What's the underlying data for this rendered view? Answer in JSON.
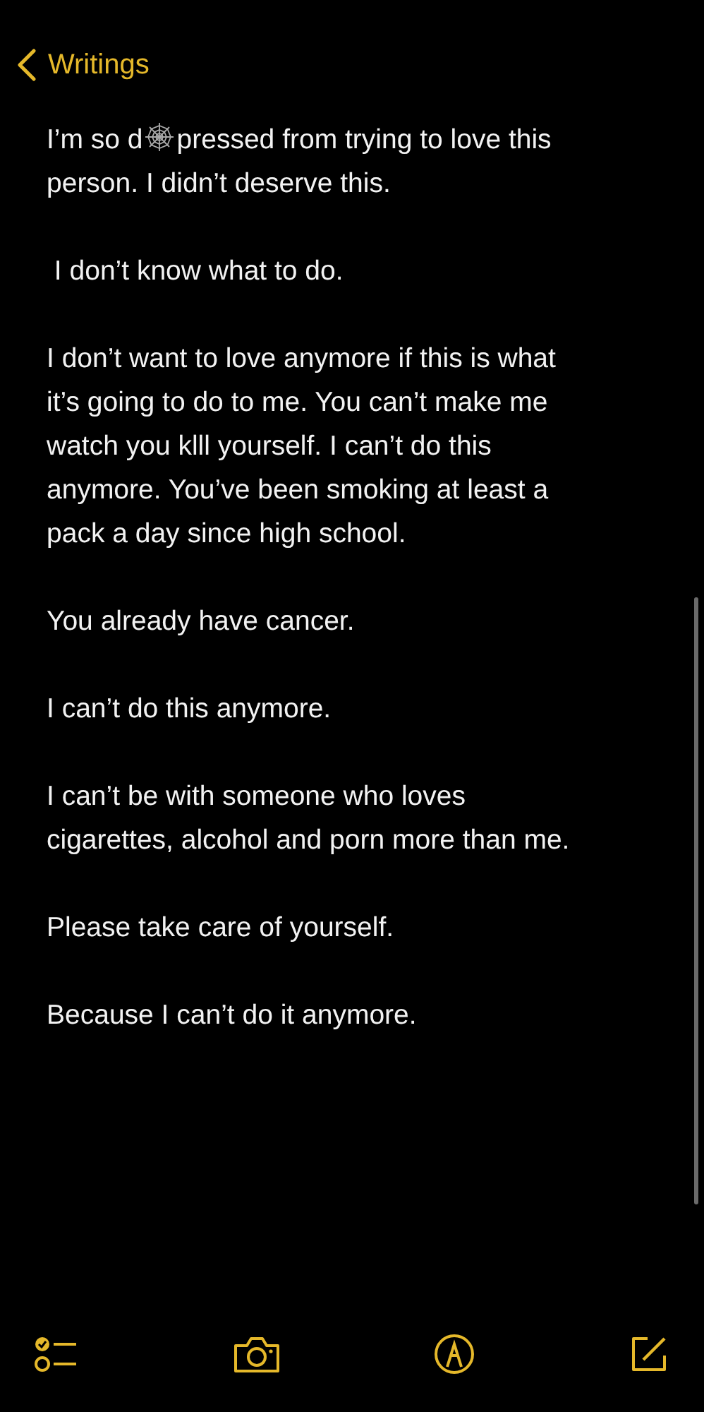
{
  "nav": {
    "back_label": "Writings"
  },
  "note": {
    "paragraphs": [
      {
        "kind": "icon_start",
        "before": "I’m so d",
        "after": "pressed from trying to love this",
        "lines": [
          "person. I didn’t deserve this."
        ]
      },
      {
        "kind": "text",
        "lines": [
          " I don’t know what to do."
        ]
      },
      {
        "kind": "text",
        "lines": [
          "I don’t want to love anymore if this is what",
          "it’s going to do to me. You can’t make me",
          "watch you klll yourself. I can’t do this",
          "anymore. You’ve been smoking at least a",
          "pack a day since high school."
        ]
      },
      {
        "kind": "text",
        "lines": [
          "You already have cancer."
        ]
      },
      {
        "kind": "text",
        "lines": [
          "I can’t do this anymore."
        ]
      },
      {
        "kind": "text",
        "lines": [
          "I can’t be with someone who loves",
          "cigarettes, alcohol and porn more than me."
        ]
      },
      {
        "kind": "text",
        "lines": [
          "Please take care of yourself."
        ]
      },
      {
        "kind": "text",
        "lines": [
          "Because I can’t do it anymore."
        ]
      }
    ]
  }
}
